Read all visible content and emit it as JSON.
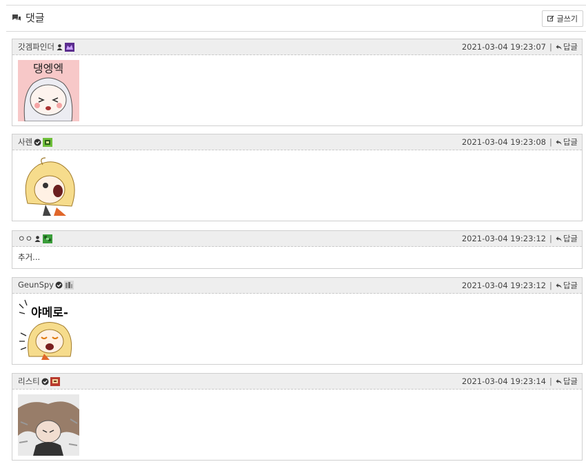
{
  "section": {
    "title": "댓글",
    "write_label": "글쓰기"
  },
  "comments": [
    {
      "author": "갓겜파인더",
      "timestamp": "2021-03-04 19:23:07",
      "separator": "|",
      "reply_label": "답글",
      "level_color": "#5b2d8e"
    },
    {
      "author": "사렌",
      "timestamp": "2021-03-04 19:23:08",
      "separator": "|",
      "reply_label": "답글",
      "level_color": "#6fbf3b"
    },
    {
      "author": "ㅇㅇ",
      "timestamp": "2021-03-04 19:23:12",
      "separator": "|",
      "reply_label": "답글",
      "body": "추거...",
      "level_color": "#3a9d3a"
    },
    {
      "author": "GeunSpy",
      "timestamp": "2021-03-04 19:23:12",
      "separator": "|",
      "reply_label": "답글",
      "level_color": "#9a9a9a"
    },
    {
      "author": "리스티",
      "timestamp": "2021-03-04 19:23:14",
      "separator": "|",
      "reply_label": "답글",
      "level_color": "#b83a2e"
    }
  ],
  "stickers": [
    {
      "caption": "댕엥엑"
    },
    {
      "caption": ""
    },
    {
      "caption": "야메로-"
    },
    {
      "caption": ""
    }
  ]
}
